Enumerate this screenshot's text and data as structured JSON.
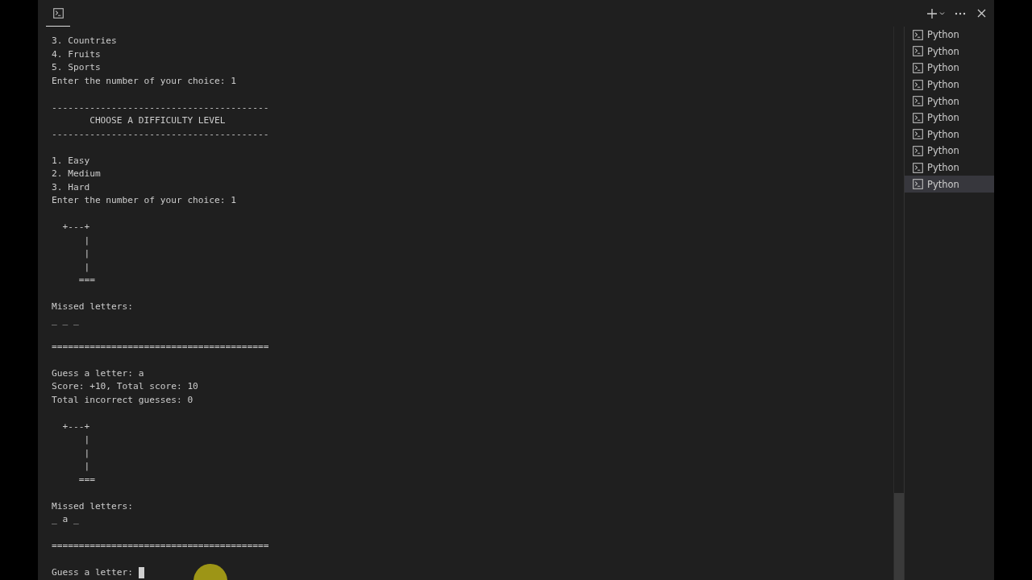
{
  "terminal": {
    "lines": [
      {
        "kind": "text",
        "text": "3. Countries"
      },
      {
        "kind": "text",
        "text": "4. Fruits"
      },
      {
        "kind": "text",
        "text": "5. Sports"
      },
      {
        "kind": "text",
        "text": "Enter the number of your choice: 1"
      },
      {
        "kind": "blank"
      },
      {
        "kind": "text",
        "text": "----------------------------------------"
      },
      {
        "kind": "text",
        "text": "       CHOOSE A DIFFICULTY LEVEL"
      },
      {
        "kind": "text",
        "text": "----------------------------------------"
      },
      {
        "kind": "blank"
      },
      {
        "kind": "text",
        "text": "1. Easy"
      },
      {
        "kind": "text",
        "text": "2. Medium"
      },
      {
        "kind": "text",
        "text": "3. Hard"
      },
      {
        "kind": "text",
        "text": "Enter the number of your choice: 1"
      },
      {
        "kind": "blank"
      },
      {
        "kind": "text",
        "text": "  +---+"
      },
      {
        "kind": "text",
        "text": "      |"
      },
      {
        "kind": "text",
        "text": "      |"
      },
      {
        "kind": "text",
        "text": "      |"
      },
      {
        "kind": "text",
        "text": "     ==="
      },
      {
        "kind": "blank"
      },
      {
        "kind": "text",
        "text": "Missed letters:"
      },
      {
        "kind": "text",
        "text": "_ _ _"
      },
      {
        "kind": "blank"
      },
      {
        "kind": "text",
        "text": "========================================"
      },
      {
        "kind": "blank"
      },
      {
        "kind": "text",
        "text": "Guess a letter: a"
      },
      {
        "kind": "text",
        "text": "Score: +10, Total score: 10"
      },
      {
        "kind": "text",
        "text": "Total incorrect guesses: 0"
      },
      {
        "kind": "blank"
      },
      {
        "kind": "text",
        "text": "  +---+"
      },
      {
        "kind": "text",
        "text": "      |"
      },
      {
        "kind": "text",
        "text": "      |"
      },
      {
        "kind": "text",
        "text": "      |"
      },
      {
        "kind": "text",
        "text": "     ==="
      },
      {
        "kind": "blank"
      },
      {
        "kind": "text",
        "text": "Missed letters:"
      },
      {
        "kind": "text",
        "text": "_ a _"
      },
      {
        "kind": "blank"
      },
      {
        "kind": "text",
        "text": "========================================"
      },
      {
        "kind": "blank"
      },
      {
        "kind": "prompt",
        "text": "Guess a letter: "
      }
    ]
  },
  "terminal_list": [
    {
      "label": "Python",
      "selected": false
    },
    {
      "label": "Python",
      "selected": false
    },
    {
      "label": "Python",
      "selected": false
    },
    {
      "label": "Python",
      "selected": false
    },
    {
      "label": "Python",
      "selected": false
    },
    {
      "label": "Python",
      "selected": false
    },
    {
      "label": "Python",
      "selected": false
    },
    {
      "label": "Python",
      "selected": false
    },
    {
      "label": "Python",
      "selected": false
    },
    {
      "label": "Python",
      "selected": true
    }
  ]
}
